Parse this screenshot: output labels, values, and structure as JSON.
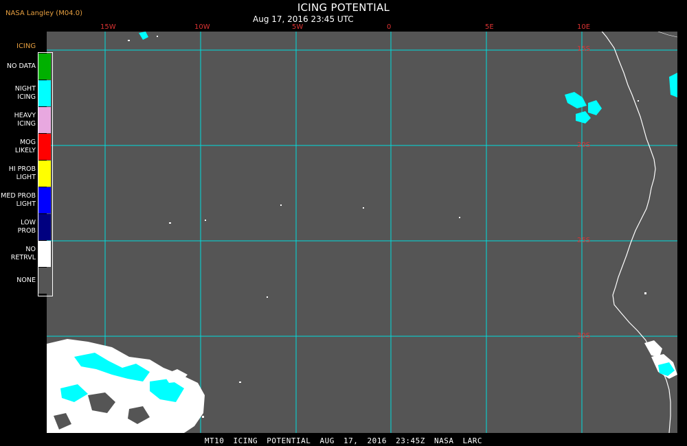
{
  "header": {
    "source": "NASA Langley (M04.0)",
    "title": "ICING POTENTIAL",
    "subtitle": "Aug 17, 2016 23:45 UTC"
  },
  "map": {
    "lon_labels": [
      "15W",
      "10W",
      "5W",
      "0",
      "5E",
      "10E"
    ],
    "lat_labels": [
      "15S",
      "20S",
      "25S",
      "30S"
    ],
    "colors": {
      "background": "#555555",
      "grid": "#00dddd",
      "coast": "#ffffff",
      "label": "#dd3333",
      "night_icing": "#00ffff",
      "no_retrieval": "#ffffff"
    }
  },
  "legend": {
    "title": "ICING",
    "items": [
      {
        "label": "NO DATA",
        "color": "#00b000"
      },
      {
        "label": "NIGHT\nICING",
        "color": "#00ffff"
      },
      {
        "label": "HEAVY\nICING",
        "color": "#e8a8e0"
      },
      {
        "label": "MOG\nLIKELY",
        "color": "#ff0000"
      },
      {
        "label": "HI PROB\nLIGHT",
        "color": "#ffff00"
      },
      {
        "label": "MED PROB\nLIGHT",
        "color": "#0000ff"
      },
      {
        "label": "LOW\nPROB",
        "color": "#000080"
      },
      {
        "label": "NO\nRETRVL",
        "color": "#ffffff"
      },
      {
        "label": "NONE",
        "color": "#555555"
      }
    ]
  },
  "footer": {
    "text": "MT10 ICING POTENTIAL AUG 17, 2016 23:45Z NASA LARC"
  }
}
